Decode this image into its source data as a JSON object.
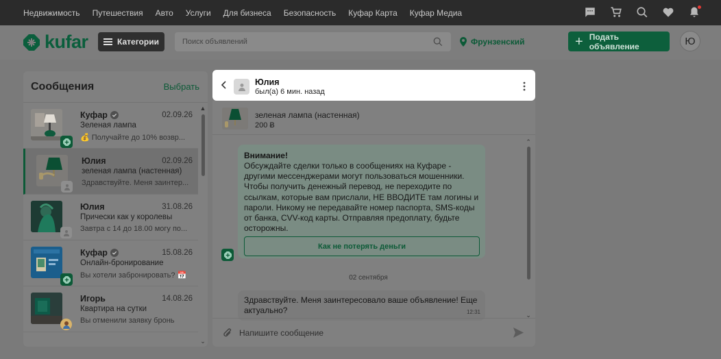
{
  "topnav": {
    "links": [
      "Недвижимость",
      "Путешествия",
      "Авто",
      "Услуги",
      "Для бизнеса",
      "Безопасность",
      "Куфар Карта",
      "Куфар Медиа"
    ]
  },
  "header": {
    "logo_text": "kufar",
    "categories_label": "Категории",
    "search_placeholder": "Поиск объявлений",
    "location": "Фрунзенский",
    "post_label": "Подать объявление",
    "avatar_letter": "Ю"
  },
  "messages": {
    "title": "Сообщения",
    "select_label": "Выбрать",
    "conversations": [
      {
        "name": "Куфар",
        "verified": true,
        "date": "02.09.26",
        "subject": "Зеленая лампа",
        "preview": "💰 Получайте до 10% возвр..."
      },
      {
        "name": "Юлия",
        "verified": false,
        "date": "02.09.26",
        "subject": "зеленая лампа (настенная)",
        "preview": "Здравствуйте. Меня заинтер..."
      },
      {
        "name": "Юлия",
        "verified": false,
        "date": "31.08.26",
        "subject": "Прически как у королевы",
        "preview": "Завтра с 14 до 18.00 могу по..."
      },
      {
        "name": "Куфар",
        "verified": true,
        "date": "15.08.26",
        "subject": "Онлайн-бронирование",
        "preview": "Вы хотели забронировать? 📅"
      },
      {
        "name": "Игорь",
        "verified": false,
        "date": "14.08.26",
        "subject": "Квартира на сутки",
        "preview": "Вы отменили заявку бронь"
      }
    ]
  },
  "chat": {
    "contact_name": "Юлия",
    "contact_status": "был(а) 6 мин. назад",
    "product_title": "зеленая лампа (настенная)",
    "product_price": "200 Ƀ",
    "warning_title": "Внимание!",
    "warning_text": "Обсуждайте сделки только в сообщениях на Куфаре - другими мессенджерами могут пользоваться мошенники. Чтобы получить денежный перевод, не переходите по ссылкам, которые вам прислали, НЕ ВВОДИТЕ там логины и пароли. Никому не передавайте номер паспорта, SMS-коды от банка, CVV-код карты. Отправляя предоплату, будьте осторожны.",
    "warning_button": "Как не потерять деньги",
    "date_separator": "02 сентября",
    "message_text": "Здравствуйте. Меня заинтересовало ваше объявление! Еще актуально?",
    "message_time": "12:31",
    "input_placeholder": "Напишите сообщение"
  },
  "colors": {
    "brand_green": "#0c5a37",
    "overlay_gray": "#7a7a7a",
    "topbar": "#2b2b2b"
  },
  "icons": [
    "chat-icon",
    "cart-icon",
    "search-heart-icon",
    "heart-icon",
    "bell-icon",
    "search-icon",
    "location-pin-icon",
    "verified-icon",
    "back-icon",
    "more-vertical-icon",
    "attach-icon",
    "send-icon"
  ]
}
